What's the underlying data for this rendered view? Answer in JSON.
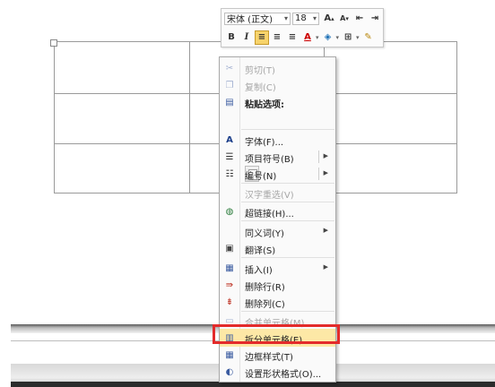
{
  "mini_toolbar": {
    "font_name": "宋体 (正文)",
    "font_size": "18",
    "grow_font": "A",
    "shrink_font": "A",
    "bold": "B",
    "italic": "I",
    "underline_color_label": "A"
  },
  "context_menu": {
    "items": [
      {
        "label": "剪切(T)",
        "icon": "scissors-icon",
        "disabled": true
      },
      {
        "label": "复制(C)",
        "icon": "copy-icon",
        "disabled": true
      },
      {
        "label": "粘贴选项:",
        "icon": "paste-icon",
        "header": true
      },
      {
        "label": "字体(F)...",
        "icon": "font-icon"
      },
      {
        "label": "项目符号(B)",
        "icon": "bullets-icon",
        "submenu": true
      },
      {
        "label": "编号(N)",
        "icon": "numbering-icon",
        "submenu": true
      },
      {
        "label": "汉字重选(V)",
        "disabled": true
      },
      {
        "label": "超链接(H)...",
        "icon": "hyperlink-icon"
      },
      {
        "label": "同义词(Y)",
        "submenu": true
      },
      {
        "label": "翻译(S)",
        "icon": "translate-icon"
      },
      {
        "label": "插入(I)",
        "icon": "insert-icon",
        "submenu": true
      },
      {
        "label": "删除行(R)",
        "icon": "delete-row-icon"
      },
      {
        "label": "删除列(C)",
        "icon": "delete-column-icon"
      },
      {
        "label": "合并单元格(M)",
        "icon": "merge-cells-icon",
        "disabled": true
      },
      {
        "label": "拆分单元格(E)...",
        "icon": "split-cells-icon",
        "highlighted": true
      },
      {
        "label": "边框样式(T)",
        "icon": "border-style-icon"
      },
      {
        "label": "设置形状格式(O)...",
        "icon": "format-shape-icon"
      }
    ]
  },
  "colors": {
    "highlight": "#fde8a6",
    "annotation_red": "#e32b2b",
    "active_button": "#f7d36b"
  }
}
